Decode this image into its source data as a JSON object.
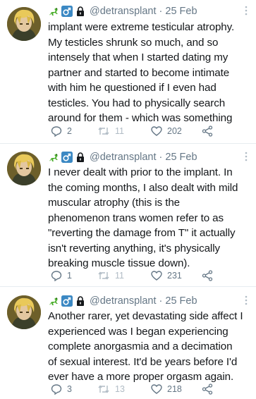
{
  "tweets": [
    {
      "handle": "@detransplant",
      "time": "25 Feb",
      "text": "implant were extreme testicular atrophy.\nMy testicles shrunk so much, and so\nintensely that when I started dating my\npartner and started to become intimate\nwith him he questioned if I even had\ntesticles. You had to physically search\naround for them - which was something",
      "replies": "2",
      "retweets": "11",
      "likes": "202"
    },
    {
      "handle": "@detransplant",
      "time": "25 Feb",
      "text": "I never dealt with prior to the implant. In\nthe coming months, I also dealt with mild\nmuscular atrophy (this is the\nphenomenon trans women refer to as\n\"reverting the damage from T\" it actually\nisn't reverting anything, it's physically\nbreaking muscle tissue down).",
      "replies": "1",
      "retweets": "11",
      "likes": "231"
    },
    {
      "handle": "@detransplant",
      "time": "25 Feb",
      "text": "Another rarer, yet devastating side affect I\nexperienced was I began experiencing\ncomplete anorgasmia and a decimation\nof sexual interest. It'd be years before I'd\never have a more proper orgasm again.",
      "replies": "3",
      "retweets": "13",
      "likes": "218"
    }
  ],
  "header": {
    "separator": "·",
    "icons": [
      "lizard-emoji-icon",
      "male-sign-emoji-icon",
      "lock-icon"
    ]
  },
  "colors": {
    "text": "#14171a",
    "meta": "#657786",
    "muted_retweet": "#b1bcc5",
    "divider": "#e6ecf0",
    "emoji_green": "#4caf2e",
    "emoji_blue": "#3b88c3"
  }
}
